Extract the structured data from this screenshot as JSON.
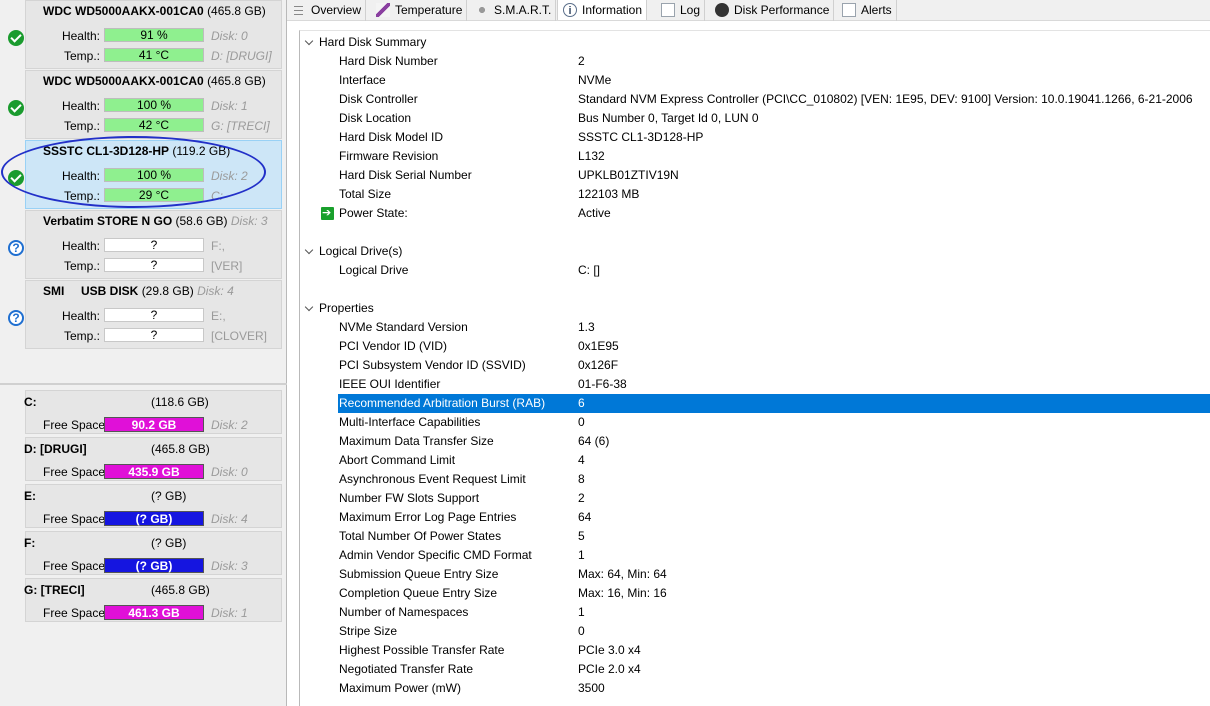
{
  "disks": [
    {
      "model": "WDC WD5000AAKX-001CA0",
      "size": "(465.8 GB)",
      "disk_suffix": "",
      "status": "ok",
      "health_label": "Health:",
      "health": "91 %",
      "temp_label": "Temp.:",
      "temp": "41 °C",
      "right1": "Disk: 0",
      "right2": "D: [DRUGI]"
    },
    {
      "model": "WDC WD5000AAKX-001CA0",
      "size": "(465.8 GB)",
      "disk_suffix": "",
      "status": "ok",
      "health_label": "Health:",
      "health": "100 %",
      "temp_label": "Temp.:",
      "temp": "42 °C",
      "right1": "Disk: 1",
      "right2": "G: [TRECI]"
    },
    {
      "model": "SSSTC CL1-3D128-HP",
      "size": "(119.2 GB)",
      "disk_suffix": "",
      "status": "ok",
      "health_label": "Health:",
      "health": "100 %",
      "temp_label": "Temp.:",
      "temp": "29 °C",
      "right1": "Disk: 2",
      "right2": "C:"
    },
    {
      "model": "Verbatim STORE N GO",
      "size": "(58.6 GB)",
      "disk_suffix": "Disk: 3",
      "status": "unknown",
      "health_label": "Health:",
      "health": "?",
      "temp_label": "Temp.:",
      "temp": "?",
      "right1": "F:,",
      "right2": "[VER]"
    },
    {
      "model": "SMI     USB DISK",
      "size": "(29.8 GB)",
      "disk_suffix": "Disk: 4",
      "status": "unknown",
      "health_label": "Health:",
      "health": "?",
      "temp_label": "Temp.:",
      "temp": "?",
      "right1": "E:,",
      "right2": "[CLOVER]"
    }
  ],
  "volumes": [
    {
      "name": "C:",
      "size": "(118.6 GB)",
      "free_label": "Free Space",
      "free": "90.2 GB",
      "disk": "Disk: 2",
      "color": "#e010d8"
    },
    {
      "name": "D: [DRUGI]",
      "size": "(465.8 GB)",
      "free_label": "Free Space",
      "free": "435.9 GB",
      "disk": "Disk: 0",
      "color": "#e010d8"
    },
    {
      "name": "E:",
      "size": "(? GB)",
      "free_label": "Free Space",
      "free": "(? GB)",
      "disk": "Disk: 4",
      "color": "#1515e0"
    },
    {
      "name": "F:",
      "size": "(? GB)",
      "free_label": "Free Space",
      "free": "(? GB)",
      "disk": "Disk: 3",
      "color": "#1515e0"
    },
    {
      "name": "G: [TRECI]",
      "size": "(465.8 GB)",
      "free_label": "Free Space",
      "free": "461.3 GB",
      "disk": "Disk: 1",
      "color": "#e010d8"
    }
  ],
  "tabs": [
    "Overview",
    "Temperature",
    "S.M.A.R.T.",
    "Information",
    "Log",
    "Disk Performance",
    "Alerts"
  ],
  "sections": {
    "summary": {
      "title": "Hard Disk Summary",
      "rows": [
        {
          "k": "Hard Disk Number",
          "v": "2"
        },
        {
          "k": "Interface",
          "v": "NVMe"
        },
        {
          "k": "Disk Controller",
          "v": "Standard NVM Express Controller (PCI\\CC_010802) [VEN: 1E95, DEV: 9100] Version: 10.0.19041.1266, 6-21-2006"
        },
        {
          "k": "Disk Location",
          "v": "Bus Number 0, Target Id 0, LUN 0"
        },
        {
          "k": "Hard Disk Model ID",
          "v": "SSSTC CL1-3D128-HP"
        },
        {
          "k": "Firmware Revision",
          "v": "L132"
        },
        {
          "k": "Hard Disk Serial Number",
          "v": "UPKLB01ZTIV19N"
        },
        {
          "k": "Total Size",
          "v": "122103 MB"
        },
        {
          "k": "Power State:",
          "v": "Active"
        }
      ]
    },
    "logical": {
      "title": "Logical Drive(s)",
      "rows": [
        {
          "k": "Logical Drive",
          "v": "C: []"
        }
      ]
    },
    "properties": {
      "title": "Properties",
      "rows": [
        {
          "k": "NVMe Standard Version",
          "v": "1.3"
        },
        {
          "k": "PCI Vendor ID (VID)",
          "v": "0x1E95"
        },
        {
          "k": "PCI Subsystem Vendor ID (SSVID)",
          "v": "0x126F"
        },
        {
          "k": "IEEE OUI Identifier",
          "v": "01-F6-38"
        },
        {
          "k": "Recommended Arbitration Burst (RAB)",
          "v": "6"
        },
        {
          "k": "Multi-Interface Capabilities",
          "v": "0"
        },
        {
          "k": "Maximum Data Transfer Size",
          "v": "64 (6)"
        },
        {
          "k": "Abort Command Limit",
          "v": "4"
        },
        {
          "k": "Asynchronous Event Request Limit",
          "v": "8"
        },
        {
          "k": "Number FW Slots Support",
          "v": "2"
        },
        {
          "k": "Maximum Error Log Page Entries",
          "v": "64"
        },
        {
          "k": "Total Number Of Power States",
          "v": "5"
        },
        {
          "k": "Admin Vendor Specific CMD Format",
          "v": "1"
        },
        {
          "k": "Submission Queue Entry Size",
          "v": "Max: 64, Min: 64"
        },
        {
          "k": "Completion Queue Entry Size",
          "v": "Max: 16, Min: 16"
        },
        {
          "k": "Number of Namespaces",
          "v": "1"
        },
        {
          "k": "Stripe Size",
          "v": "0"
        },
        {
          "k": "Highest Possible Transfer Rate",
          "v": "PCIe 3.0 x4"
        },
        {
          "k": "Negotiated Transfer Rate",
          "v": "PCIe 2.0 x4"
        },
        {
          "k": "Maximum Power (mW)",
          "v": "3500"
        }
      ]
    }
  }
}
